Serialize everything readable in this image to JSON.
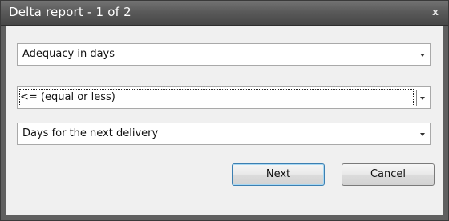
{
  "window": {
    "title": "Delta report - 1 of 2",
    "close_glyph": "x"
  },
  "fields": {
    "metric": {
      "selected": "Adequacy in days"
    },
    "operator": {
      "selected": "<= (equal or less)"
    },
    "comparison": {
      "selected": "Days for the next delivery"
    }
  },
  "buttons": {
    "next_label": "Next",
    "cancel_label": "Cancel"
  },
  "icons": {
    "close": "close-icon",
    "dropdown": "chevron-down-icon"
  }
}
